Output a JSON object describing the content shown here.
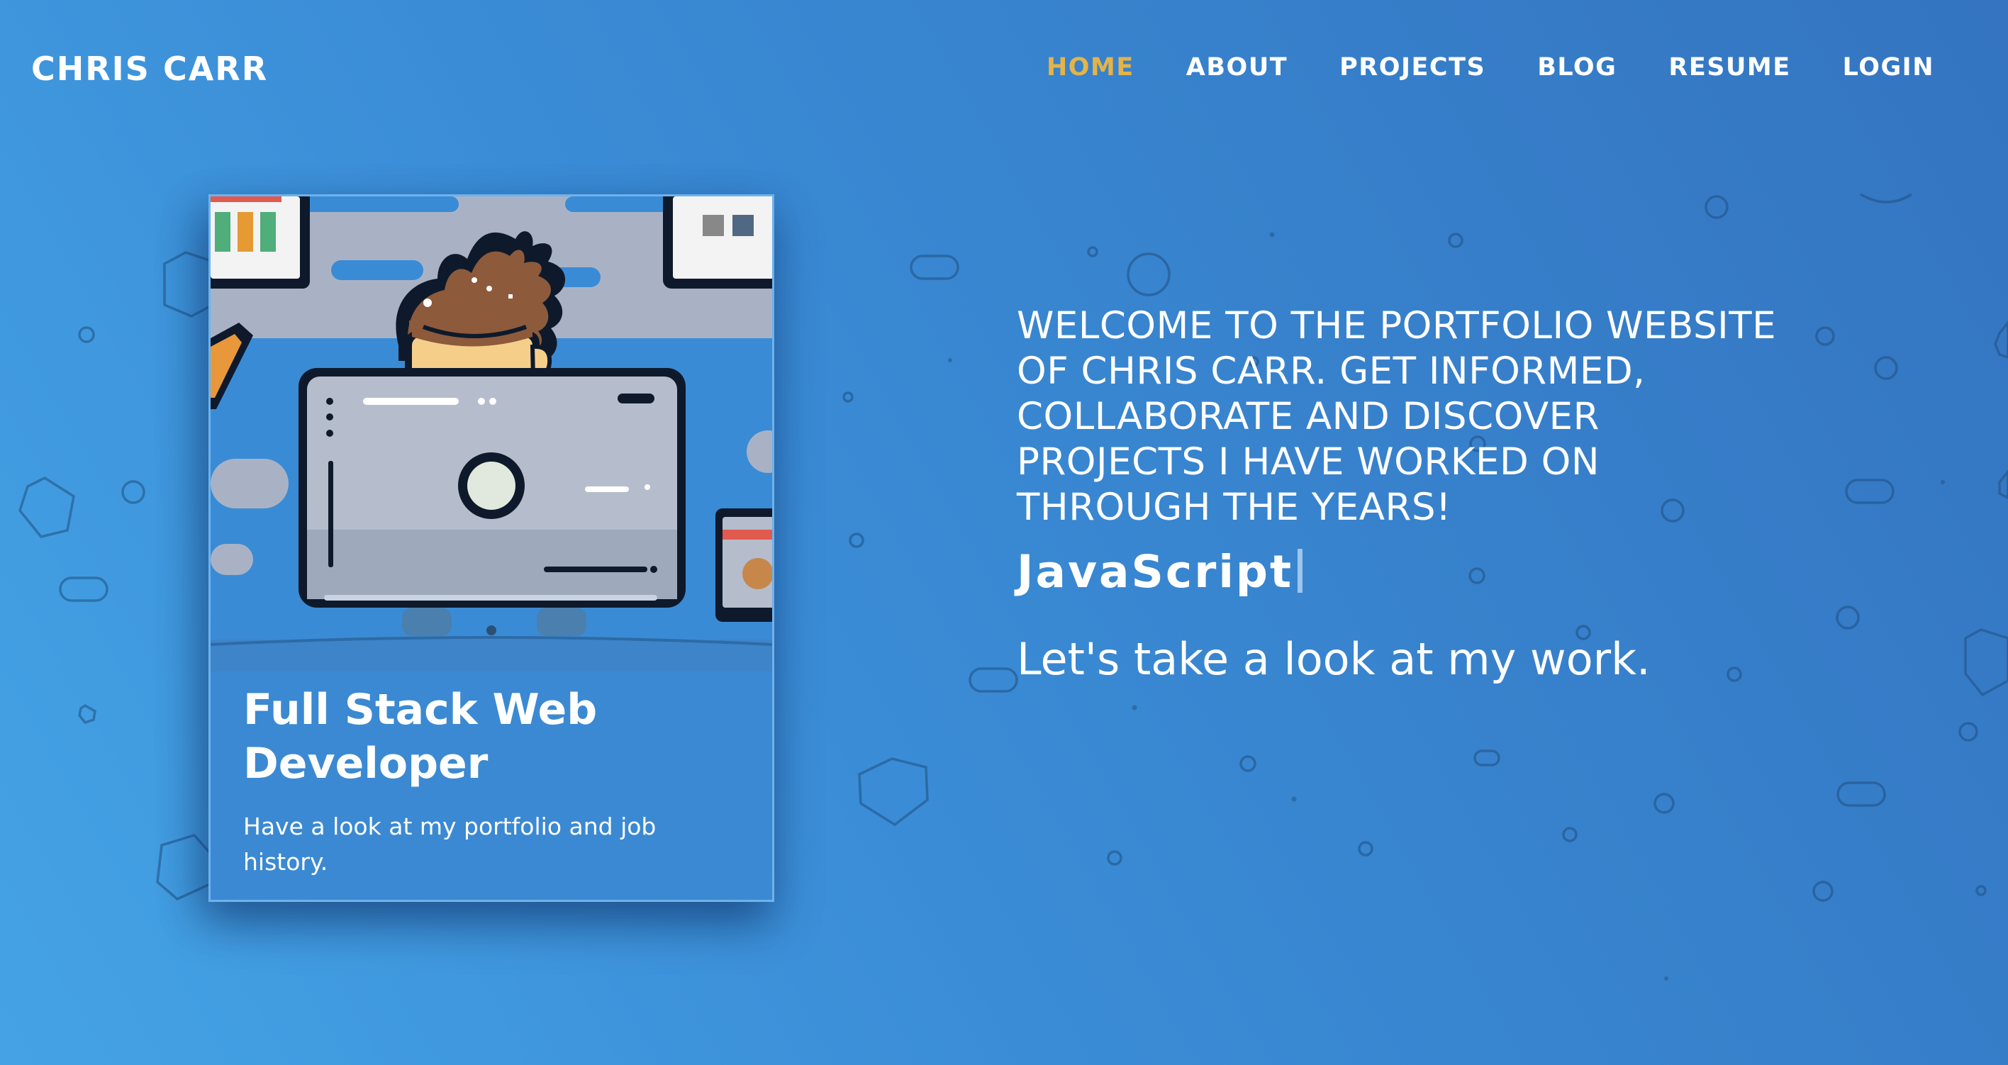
{
  "header": {
    "brand": "CHRIS CARR",
    "nav": [
      {
        "label": "HOME",
        "active": true
      },
      {
        "label": "ABOUT",
        "active": false
      },
      {
        "label": "PROJECTS",
        "active": false
      },
      {
        "label": "BLOG",
        "active": false
      },
      {
        "label": "RESUME",
        "active": false
      },
      {
        "label": "LOGIN",
        "active": false
      }
    ]
  },
  "card": {
    "image_icon": "developer-at-computer-illustration",
    "title": "Full Stack Web Developer",
    "text": "Have a look at my portfolio and job history."
  },
  "hero": {
    "welcome": "WELCOME TO THE PORTFOLIO WEBSITE OF CHRIS CARR. GET INFORMED, COLLABORATE AND DISCOVER PROJECTS I HAVE WORKED ON THROUGH THE YEARS!",
    "typed_word": "JavaScript",
    "cta": "Let's take a look at my work."
  },
  "colors": {
    "active_nav": "#e4b448",
    "background_start": "#45a3e5",
    "background_end": "#3474c0",
    "text": "#ffffff"
  }
}
